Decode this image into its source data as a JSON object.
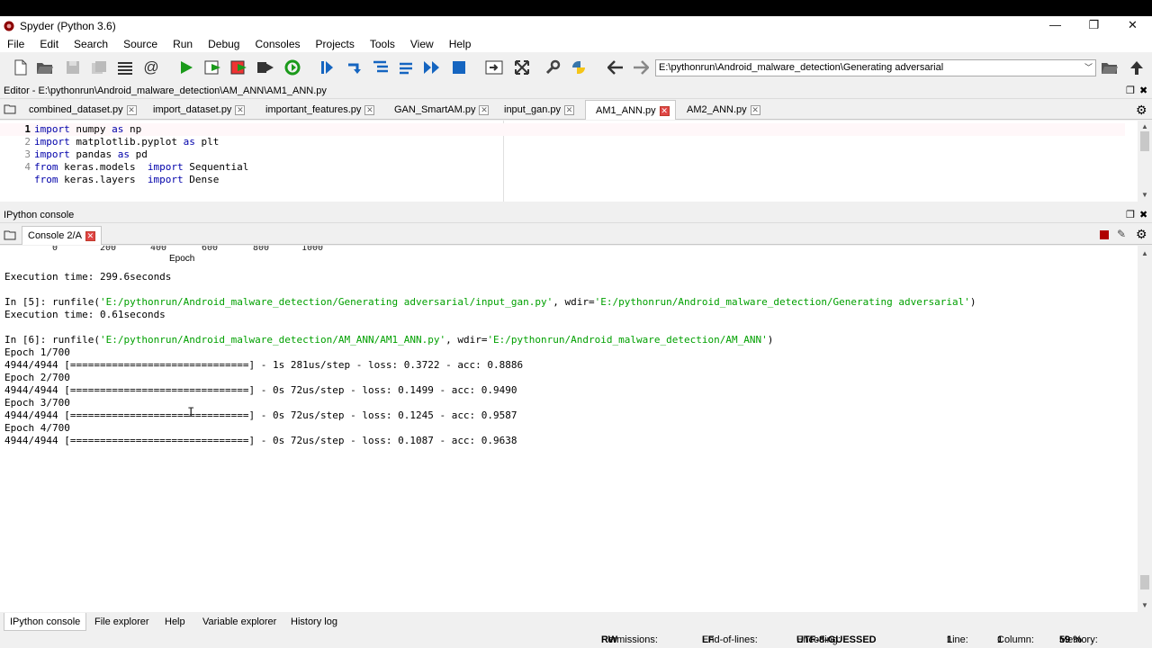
{
  "window": {
    "title": "Spyder (Python 3.6)",
    "controls": [
      "—",
      "❐",
      "✕"
    ]
  },
  "menu": [
    "File",
    "Edit",
    "Search",
    "Source",
    "Run",
    "Debug",
    "Consoles",
    "Projects",
    "Tools",
    "View",
    "Help"
  ],
  "toolbar": {
    "path_value": "E:\\pythonrun\\Android_malware_detection\\Generating adversarial"
  },
  "editor": {
    "title": "Editor - E:\\pythonrun\\Android_malware_detection\\AM_ANN\\AM1_ANN.py",
    "tabs": [
      {
        "label": "combined_dataset.py",
        "active": false
      },
      {
        "label": "import_dataset.py",
        "active": false
      },
      {
        "label": "important_features.py",
        "active": false
      },
      {
        "label": "GAN_SmartAM.py",
        "active": false
      },
      {
        "label": "input_gan.py",
        "active": false
      },
      {
        "label": "AM1_ANN.py",
        "active": true
      },
      {
        "label": "AM2_ANN.py",
        "active": false
      }
    ],
    "lines": [
      {
        "num": "1",
        "code": [
          [
            "kw",
            "import"
          ],
          [
            "",
            "numpy"
          ],
          [
            "kw",
            " as"
          ],
          [
            "",
            " np"
          ]
        ]
      },
      {
        "num": "2",
        "code": [
          [
            "kw",
            "import"
          ],
          [
            "",
            "matplotlib.pyplot"
          ],
          [
            "kw",
            " as"
          ],
          [
            "",
            " plt"
          ]
        ]
      },
      {
        "num": "3",
        "code": [
          [
            "kw",
            "import"
          ],
          [
            "",
            "pandas"
          ],
          [
            "kw",
            " as"
          ],
          [
            "",
            " pd"
          ]
        ]
      },
      {
        "num": "4",
        "code": [
          [
            "kw",
            "from"
          ],
          [
            "",
            " keras.models "
          ],
          [
            "kw",
            "import"
          ],
          [
            "",
            " Sequential"
          ]
        ]
      },
      {
        "num": "",
        "code": [
          [
            "kw",
            "from"
          ],
          [
            "",
            " keras.layers "
          ],
          [
            "kw",
            "import"
          ],
          [
            "",
            " Dense"
          ]
        ]
      }
    ]
  },
  "console": {
    "title": "IPython console",
    "tab_label": "Console 2/A",
    "plot_ticks": [
      "0",
      "200",
      "400",
      "600",
      "800",
      "1000"
    ],
    "plot_xlabel": "Epoch",
    "lines": [
      {
        "parts": [
          [
            "",
            "Execution time: 299.6seconds"
          ]
        ]
      },
      {
        "parts": []
      },
      {
        "parts": [
          [
            "",
            "In [5]: runfile("
          ],
          [
            "str",
            "'E:/pythonrun/Android_malware_detection/Generating adversarial/input_gan.py'"
          ],
          [
            "",
            ", wdir="
          ],
          [
            "str",
            "'E:/pythonrun/Android_malware_detection/Generating adversarial'"
          ],
          [
            "",
            ")"
          ]
        ]
      },
      {
        "parts": [
          [
            "",
            "Execution time: 0.61seconds"
          ]
        ]
      },
      {
        "parts": []
      },
      {
        "parts": [
          [
            "",
            "In [6]: runfile("
          ],
          [
            "str",
            "'E:/pythonrun/Android_malware_detection/AM_ANN/AM1_ANN.py'"
          ],
          [
            "",
            ", wdir="
          ],
          [
            "str",
            "'E:/pythonrun/Android_malware_detection/AM_ANN'"
          ],
          [
            "",
            ")"
          ]
        ]
      },
      {
        "parts": [
          [
            "",
            "Epoch 1/700"
          ]
        ]
      },
      {
        "parts": [
          [
            "",
            "4944/4944 [==============================] - 1s 281us/step - loss: 0.3722 - acc: 0.8886"
          ]
        ]
      },
      {
        "parts": [
          [
            "",
            "Epoch 2/700"
          ]
        ]
      },
      {
        "parts": [
          [
            "",
            "4944/4944 [==============================] - 0s 72us/step - loss: 0.1499 - acc: 0.9490"
          ]
        ]
      },
      {
        "parts": [
          [
            "",
            "Epoch 3/700"
          ]
        ]
      },
      {
        "parts": [
          [
            "",
            "4944/4944 [==============================] - 0s 72us/step - loss: 0.1245 - acc: 0.9587"
          ]
        ]
      },
      {
        "parts": [
          [
            "",
            "Epoch 4/700"
          ]
        ]
      },
      {
        "parts": [
          [
            "",
            "4944/4944 [==============================] - 0s 72us/step - loss: 0.1087 - acc: 0.9638"
          ]
        ]
      }
    ]
  },
  "bottom_tabs": [
    "IPython console",
    "File explorer",
    "Help",
    "Variable explorer",
    "History log"
  ],
  "status": {
    "permissions_label": "Permissions:",
    "permissions_value": "RW",
    "eol_label": "End-of-lines:",
    "eol_value": "LF",
    "encoding_label": "Encoding:",
    "encoding_value": "UTF-8-GUESSED",
    "line_label": "Line:",
    "line_value": "1",
    "column_label": "Column:",
    "column_value": "1",
    "memory_label": "Memory:",
    "memory_value": "59 %"
  }
}
